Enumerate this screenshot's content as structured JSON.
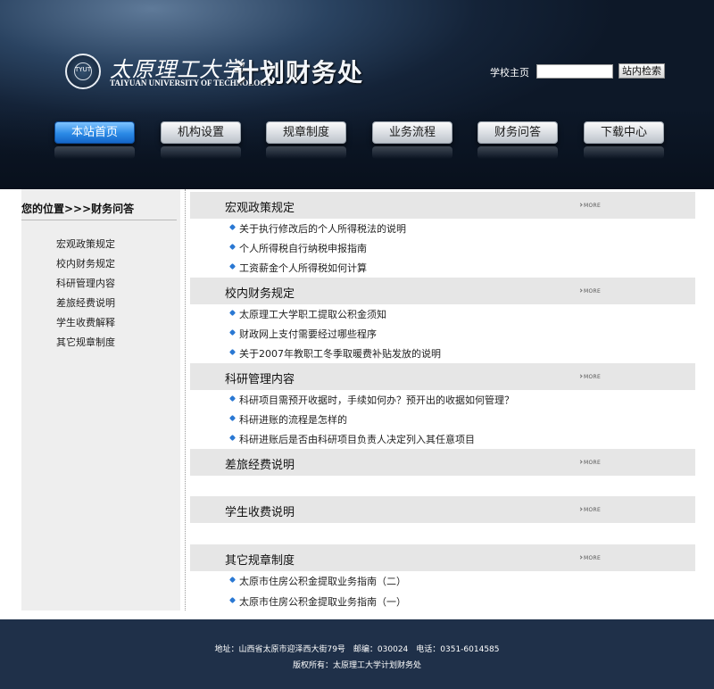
{
  "header": {
    "seal_text": "TYUT",
    "university_cn": "太原理工大学",
    "university_en": "TAIYUAN UNIVERSITY OF TECHNOLOGY",
    "dept_title": "计划财务处",
    "home_link": "学校主页",
    "search": {
      "value": "",
      "button_label": "站内检索"
    }
  },
  "nav": [
    {
      "label": "本站首页",
      "active": true
    },
    {
      "label": "机构设置",
      "active": false
    },
    {
      "label": "规章制度",
      "active": false
    },
    {
      "label": "业务流程",
      "active": false
    },
    {
      "label": "财务问答",
      "active": false
    },
    {
      "label": "下载中心",
      "active": false
    }
  ],
  "sidebar": {
    "location": "您的位置>>>财务问答",
    "items": [
      "宏观政策规定",
      "校内财务规定",
      "科研管理内容",
      "差旅经费说明",
      "学生收费解释",
      "其它规章制度"
    ]
  },
  "sections": [
    {
      "title": "宏观政策规定",
      "more": "MORE",
      "articles": [
        "关于执行修改后的个人所得税法的说明",
        "个人所得税自行纳税申报指南",
        "工资薪金个人所得税如何计算"
      ]
    },
    {
      "title": "校内财务规定",
      "more": "MORE",
      "articles": [
        "太原理工大学职工提取公积金须知",
        "财政网上支付需要经过哪些程序",
        "关于2007年教职工冬季取暖费补贴发放的说明"
      ]
    },
    {
      "title": "科研管理内容",
      "more": "MORE",
      "articles": [
        "科研项目需预开收据时，手续如何办？预开出的收据如何管理？",
        "科研进账的流程是怎样的",
        "科研进账后是否由科研项目负责人决定列入其任意项目"
      ]
    },
    {
      "title": "差旅经费说明",
      "more": "MORE",
      "articles": []
    },
    {
      "title": "学生收费说明",
      "more": "MORE",
      "articles": []
    },
    {
      "title": "其它规章制度",
      "more": "MORE",
      "articles": [
        "太原市住房公积金提取业务指南（二）",
        "太原市住房公积金提取业务指南（一）"
      ]
    }
  ],
  "footer": {
    "address": "地址：山西省太原市迎泽西大街79号　邮编：030024　电话：0351-6014585",
    "copyright": "版权所有：太原理工大学计划财务处"
  },
  "colors": {
    "header_bg": "#142338",
    "active_tab": "#2b8ae6",
    "footer_bg": "#1f3049",
    "section_bg": "#e6e6e6",
    "bullet": "#2a78d3"
  }
}
